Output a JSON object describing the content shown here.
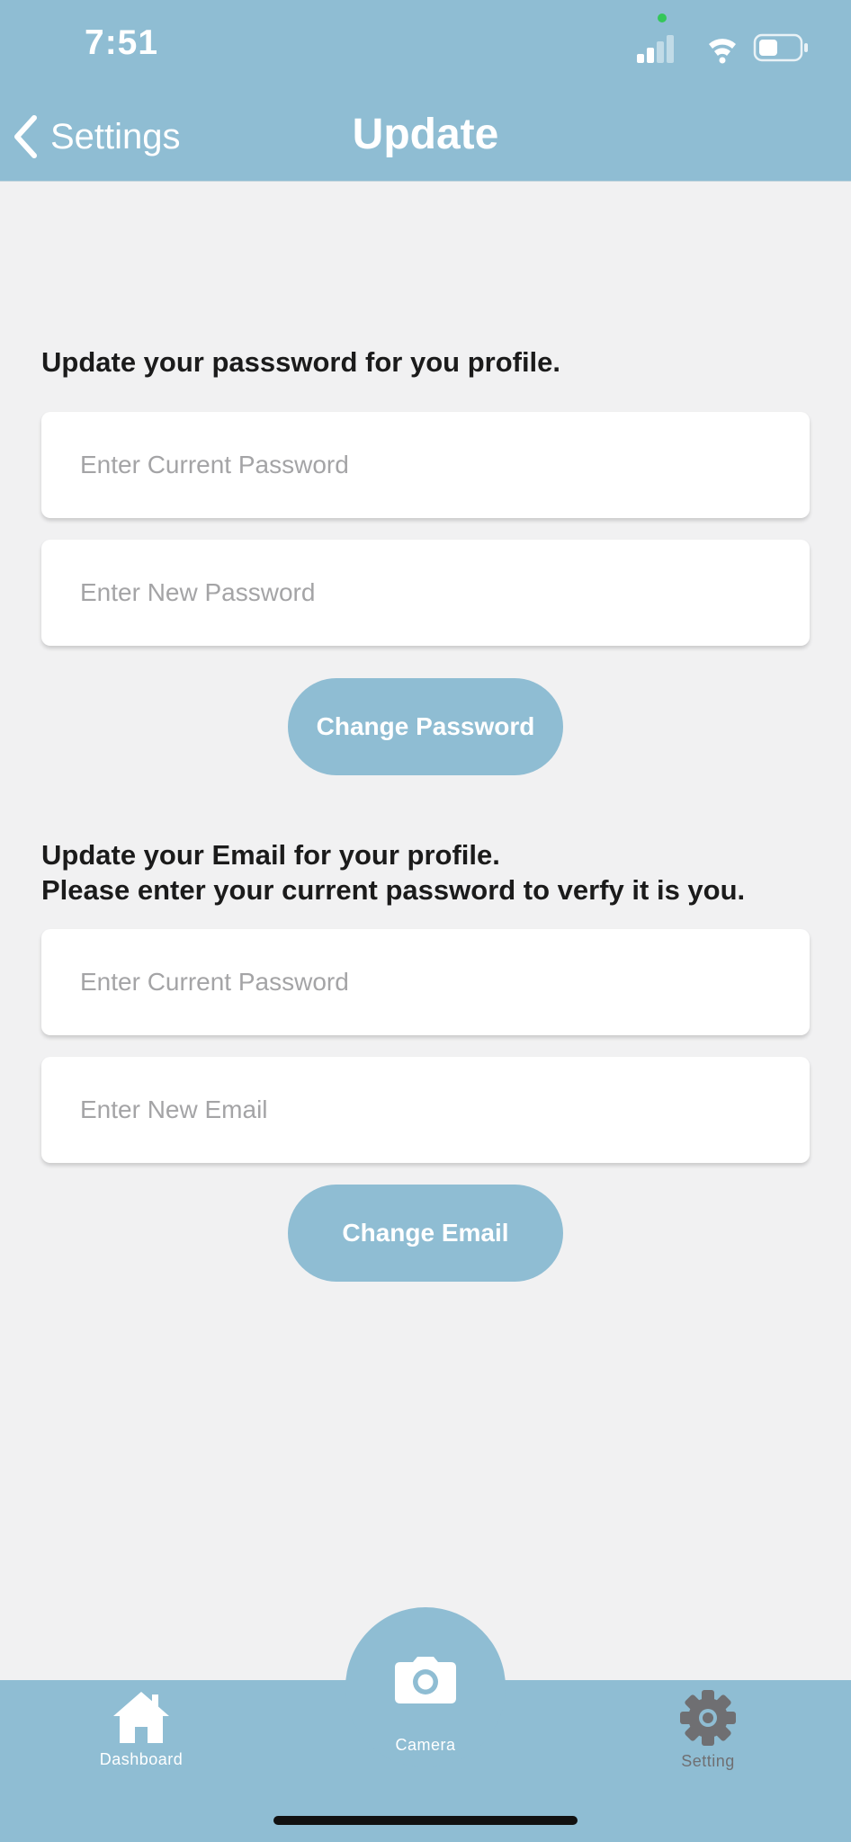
{
  "status_bar": {
    "time": "7:51"
  },
  "nav": {
    "back_label": "Settings",
    "title": "Update"
  },
  "password_section": {
    "heading": "Update your passsword for you profile.",
    "current_password_placeholder": "Enter Current Password",
    "new_password_placeholder": "Enter New Password",
    "button_label": "Change Password"
  },
  "email_section": {
    "heading_line1": "Update your Email for your profile.",
    "heading_line2": "Please enter your current password to verfy it is you.",
    "current_password_placeholder": "Enter Current Password",
    "new_email_placeholder": "Enter New Email",
    "button_label": "Change Email"
  },
  "tab_bar": {
    "items": [
      {
        "label": "Dashboard",
        "icon": "home-icon",
        "color": "#ffffff"
      },
      {
        "label": "Camera",
        "icon": "camera-icon",
        "color": "#ffffff"
      },
      {
        "label": "Setting",
        "icon": "gear-icon",
        "color": "#6f6f72"
      }
    ]
  },
  "colors": {
    "accent": "#8fbdd3",
    "background": "#f1f1f2",
    "active_tab": "#6f6f72"
  }
}
